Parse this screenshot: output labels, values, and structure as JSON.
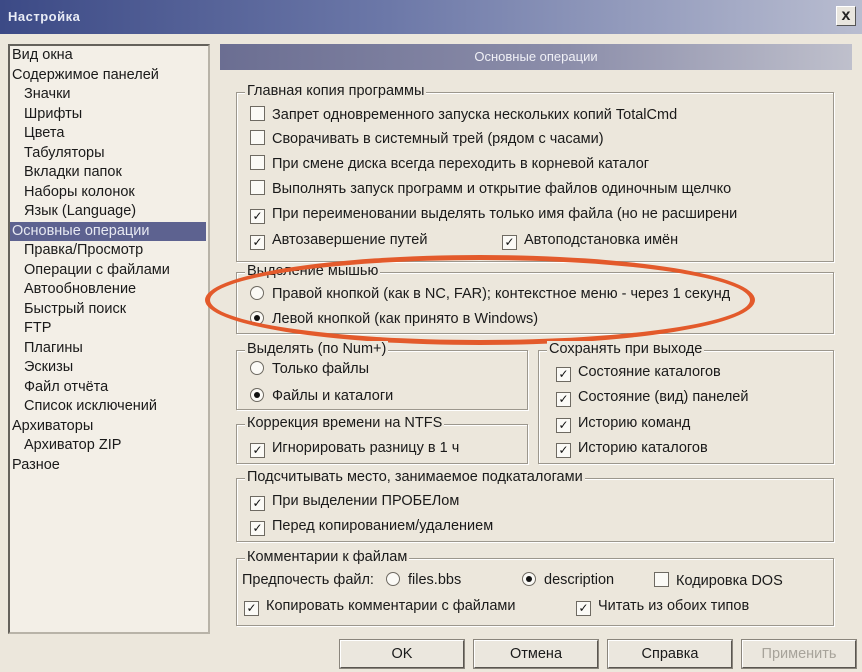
{
  "window": {
    "title": "Настройка",
    "close_label": "x"
  },
  "tree": [
    {
      "label": "Вид окна",
      "level": 1
    },
    {
      "label": "Содержимое панелей",
      "level": 1
    },
    {
      "label": "Значки",
      "level": 2
    },
    {
      "label": "Шрифты",
      "level": 2
    },
    {
      "label": "Цвета",
      "level": 2
    },
    {
      "label": "Табуляторы",
      "level": 2
    },
    {
      "label": "Вкладки папок",
      "level": 2
    },
    {
      "label": "Наборы колонок",
      "level": 2
    },
    {
      "label": "Язык (Language)",
      "level": 2
    },
    {
      "label": "Основные операции",
      "level": 1,
      "selected": true
    },
    {
      "label": "Правка/Просмотр",
      "level": 2
    },
    {
      "label": "Операции с файлами",
      "level": 2
    },
    {
      "label": "Автообновление",
      "level": 2
    },
    {
      "label": "Быстрый поиск",
      "level": 2
    },
    {
      "label": "FTP",
      "level": 2
    },
    {
      "label": "Плагины",
      "level": 2
    },
    {
      "label": "Эскизы",
      "level": 2
    },
    {
      "label": "Файл отчёта",
      "level": 2
    },
    {
      "label": "Список исключений",
      "level": 2
    },
    {
      "label": "Архиваторы",
      "level": 1
    },
    {
      "label": "Архиватор ZIP",
      "level": 2
    },
    {
      "label": "Разное",
      "level": 1
    }
  ],
  "panel_title": "Основные операции",
  "main_copy": {
    "label": "Главная копия программы",
    "items": [
      {
        "label": "Запрет одновременного запуска нескольких копий TotalCmd",
        "checked": false
      },
      {
        "label": "Сворачивать в системный трей (рядом с часами)",
        "checked": false
      },
      {
        "label": "При смене диска всегда переходить в корневой каталог",
        "checked": false
      },
      {
        "label": "Выполнять запуск программ и открытие файлов одиночным щелчко",
        "checked": false
      },
      {
        "label": "При переименовании выделять только имя файла (но не расширени",
        "checked": true
      },
      {
        "label": "Автозавершение путей",
        "checked": true
      },
      {
        "label": "Автоподстановка имён",
        "checked": true
      }
    ]
  },
  "mouse_select": {
    "label": "Выделение мышью",
    "options": [
      {
        "label": "Правой кнопкой (как в NC, FAR); контекстное меню - через 1 секунд",
        "selected": false
      },
      {
        "label": "Левой кнопкой (как принято в Windows)",
        "selected": true
      }
    ]
  },
  "select_what": {
    "label": "Выделять (по Num+)",
    "options": [
      {
        "label": "Только файлы",
        "selected": false
      },
      {
        "label": "Файлы и каталоги",
        "selected": true
      }
    ]
  },
  "save_on_exit": {
    "label": "Сохранять при выходе",
    "items": [
      {
        "label": "Состояние каталогов",
        "checked": true
      },
      {
        "label": "Состояние (вид) панелей",
        "checked": true
      },
      {
        "label": "Историю команд",
        "checked": true
      },
      {
        "label": "Историю каталогов",
        "checked": true
      }
    ]
  },
  "ntfs": {
    "label": "Коррекция времени на NTFS",
    "items": [
      {
        "label": "Игнорировать разницу в 1 ч",
        "checked": true
      }
    ]
  },
  "subdir_space": {
    "label": "Подсчитывать место, занимаемое подкаталогами",
    "items": [
      {
        "label": "При выделении ПРОБЕЛом",
        "checked": true
      },
      {
        "label": "Перед копированием/удалением",
        "checked": true
      }
    ]
  },
  "comments": {
    "label": "Комментарии к файлам",
    "prefer_label": "Предпочесть файл:",
    "opt_files_bbs": "files.bbs",
    "opt_description": "description",
    "files_bbs_selected": false,
    "description_selected": true,
    "dos_encoding": {
      "label": "Кодировка DOS",
      "checked": false
    },
    "copy_comments": {
      "label": "Копировать комментарии с файлами",
      "checked": true
    },
    "read_both": {
      "label": "Читать из обоих типов",
      "checked": true
    }
  },
  "buttons": {
    "ok": "OK",
    "cancel": "Отмена",
    "help": "Справка",
    "apply": "Применить"
  },
  "colors": {
    "accent_ellipse": "#e35a2b",
    "selection": "#5d6290"
  },
  "check_mark": "✓"
}
